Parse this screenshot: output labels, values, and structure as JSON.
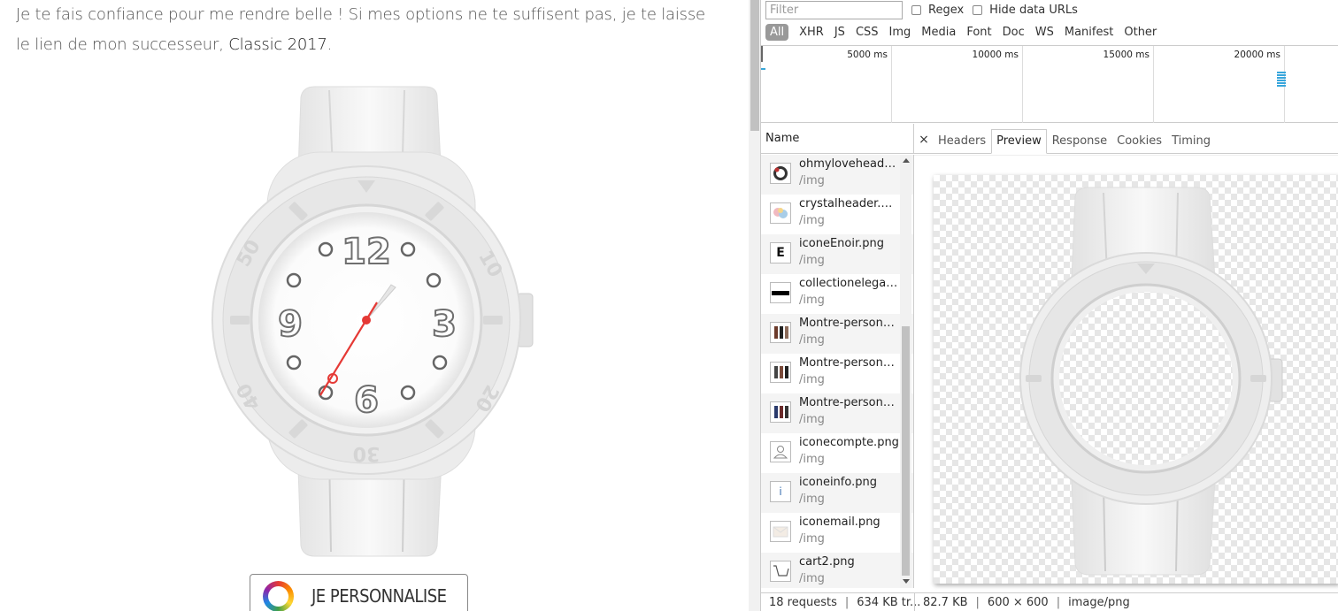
{
  "page": {
    "intro_text": "Je te fais confiance pour me rendre belle ! Si mes options ne te suffisent pas, je te laisse le lien de mon successeur, ",
    "intro_link": "Classic 2017",
    "intro_end": ".",
    "watch_numerals": [
      "12",
      "3",
      "6",
      "9"
    ],
    "bezel_numbers": [
      "10",
      "20",
      "30",
      "40",
      "50"
    ],
    "cta_label": "JE PERSONNALISE"
  },
  "devtools": {
    "filter_placeholder": "Filter",
    "regex_label": "Regex",
    "hide_data_urls_label": "Hide data URLs",
    "type_filters": [
      "All",
      "XHR",
      "JS",
      "CSS",
      "Img",
      "Media",
      "Font",
      "Doc",
      "WS",
      "Manifest",
      "Other"
    ],
    "active_filter": "All",
    "timeline_ticks": [
      "5000 ms",
      "10000 ms",
      "15000 ms",
      "20000 ms"
    ],
    "name_header": "Name",
    "requests": [
      {
        "name": "ohmyloveheader.png",
        "type": "/img",
        "icon": "watch-thumb-icon"
      },
      {
        "name": "crystalheader.png",
        "type": "/img",
        "icon": "crystal-thumb-icon"
      },
      {
        "name": "iconeEnoir.png",
        "type": "/img",
        "icon": "letter-e-icon",
        "glyph": "E"
      },
      {
        "name": "collectionelegance...",
        "type": "/img",
        "icon": "black-bar-icon"
      },
      {
        "name": "Montre-personnalis...",
        "type": "/img",
        "icon": "watches-thumb-icon"
      },
      {
        "name": "Montre-personnalis...",
        "type": "/img",
        "icon": "watches-thumb-icon"
      },
      {
        "name": "Montre-personnalis...",
        "type": "/img",
        "icon": "watches-thumb-icon"
      },
      {
        "name": "iconecompte.png",
        "type": "/img",
        "icon": "account-icon"
      },
      {
        "name": "iconeinfo.png",
        "type": "/img",
        "icon": "info-icon",
        "glyph": "i"
      },
      {
        "name": "iconemail.png",
        "type": "/img",
        "icon": "mail-icon"
      },
      {
        "name": "cart2.png",
        "type": "/img",
        "icon": "cart-icon"
      }
    ],
    "detail_tabs": [
      "Headers",
      "Preview",
      "Response",
      "Cookies",
      "Timing"
    ],
    "active_tab": "Preview",
    "close_glyph": "×",
    "status": {
      "requests": "18 requests",
      "separator": "|",
      "transferred": "634 KB tr...",
      "size": "82.7 KB",
      "dimensions": "600 × 600",
      "mime": "image/png"
    }
  }
}
